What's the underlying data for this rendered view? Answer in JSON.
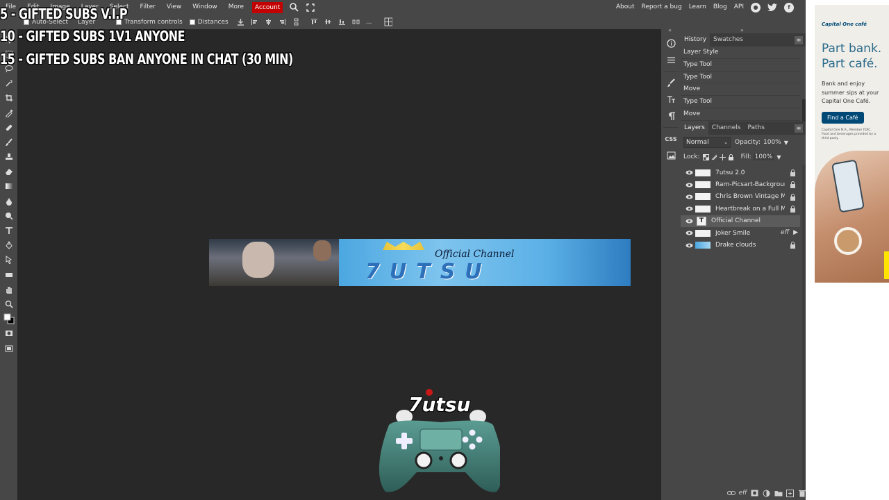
{
  "menubar": {
    "items": [
      "File",
      "Edit",
      "Image",
      "Layer",
      "Select",
      "Filter",
      "View",
      "Window",
      "More"
    ],
    "account": "Account",
    "right_links": [
      "About",
      "Report a bug",
      "Learn",
      "Blog",
      "API"
    ]
  },
  "options": {
    "auto_select": "Auto-Select",
    "target": "Layer",
    "transform_controls": "Transform controls",
    "distances": "Distances",
    "more": "..."
  },
  "overlay": {
    "line1": "5 - GIFTED SUBS V.I.P",
    "line2": "10 - GIFTED SUBS 1V1 ANYONE",
    "line3": "15 - GIFTED SUBS BAN ANYONE IN CHAT (30 MIN)"
  },
  "banner": {
    "subtitle": "Official Channel",
    "brand": "7UTSU"
  },
  "logo": {
    "text": "7utsu"
  },
  "history": {
    "tabs": [
      "History",
      "Swatches"
    ],
    "items": [
      "Layer Style",
      "Type Tool",
      "Type Tool",
      "Move",
      "Type Tool",
      "Move"
    ]
  },
  "layers": {
    "tabs": [
      "Layers",
      "Channels",
      "Paths"
    ],
    "blend_mode": "Normal",
    "opacity_label": "Opacity:",
    "opacity_value": "100%",
    "lock_label": "Lock:",
    "fill_label": "Fill:",
    "fill_value": "100%",
    "rows": [
      {
        "name": "7utsu 2.0"
      },
      {
        "name": "Ram-Picsart-Background"
      },
      {
        "name": "Chris Brown Vintage Mid"
      },
      {
        "name": "Heartbreak on a Full Moo"
      },
      {
        "name": "Official Channel"
      },
      {
        "name": "Joker Smile",
        "fx": "eff"
      },
      {
        "name": "Drake clouds"
      }
    ]
  },
  "panel_icons": {
    "css": "CSS"
  },
  "ad": {
    "logo": "Capital One café",
    "headline_1": "Part bank.",
    "headline_2": "Part café.",
    "body": "Bank and enjoy summer sips at your Capital One Café.",
    "cta": "Find a Café",
    "fine_print": "Capital One N.A., Member FDIC. Food and beverages provided by a third party."
  }
}
